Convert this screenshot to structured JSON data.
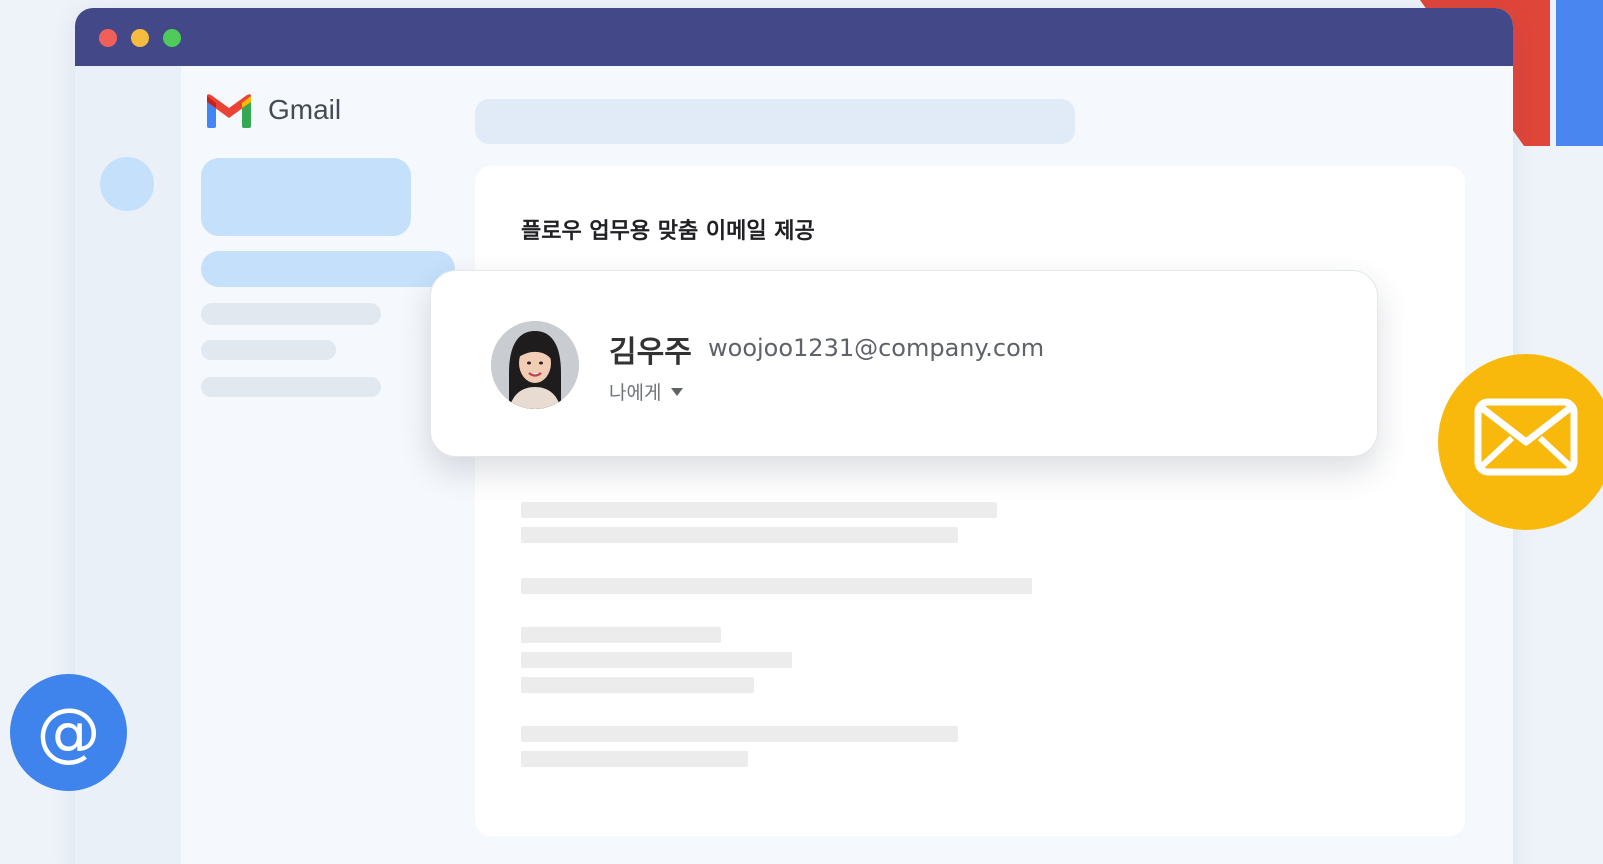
{
  "app": {
    "name": "Gmail"
  },
  "email": {
    "subject": "플로우 업무용 맞춤 이메일 제공"
  },
  "sender": {
    "name": "김우주",
    "email": "woojoo1231@company.com",
    "recipient_label": "나에게"
  },
  "icons": {
    "window_controls": [
      "close-dot",
      "minimize-dot",
      "maximize-dot"
    ],
    "gmail_logo": "gmail-m-logo",
    "dropdown": "caret-down-icon",
    "mail": "envelope-icon",
    "at": "at-sign-icon",
    "at_glyph": "@"
  },
  "colors": {
    "titlebar": "#434889",
    "accent_light_blue": "#c4e0fb",
    "mail_badge": "#f8b90c",
    "at_badge": "#3f83ed",
    "corner_red": "#e0453a",
    "corner_blue": "#4a86f0"
  }
}
